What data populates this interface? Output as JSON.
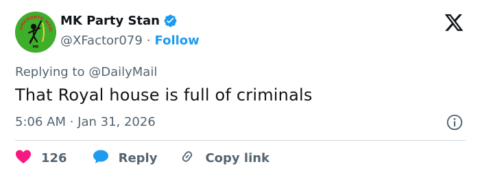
{
  "author": {
    "display_name": "MK Party Stan",
    "handle": "@XFactor079",
    "separator": "·",
    "follow_label": "Follow",
    "avatar_text": "UMKHONTO WESIZWE",
    "avatar_sub": "MK"
  },
  "tweet": {
    "reply_prefix": "Replying to",
    "reply_mention": "@DailyMail",
    "text": "That Royal house is full of criminals",
    "timestamp": "5:06 AM · Jan 31, 2026"
  },
  "actions": {
    "like_count": "126",
    "reply_label": "Reply",
    "copy_label": "Copy link"
  },
  "colors": {
    "accent": "#1d9bf0",
    "like": "#f91880",
    "muted": "#536471",
    "avatar_bg": "#3fae2a"
  },
  "icons": [
    "verified-badge-icon",
    "x-logo-icon",
    "info-icon",
    "heart-icon",
    "reply-bubble-icon",
    "link-icon"
  ]
}
